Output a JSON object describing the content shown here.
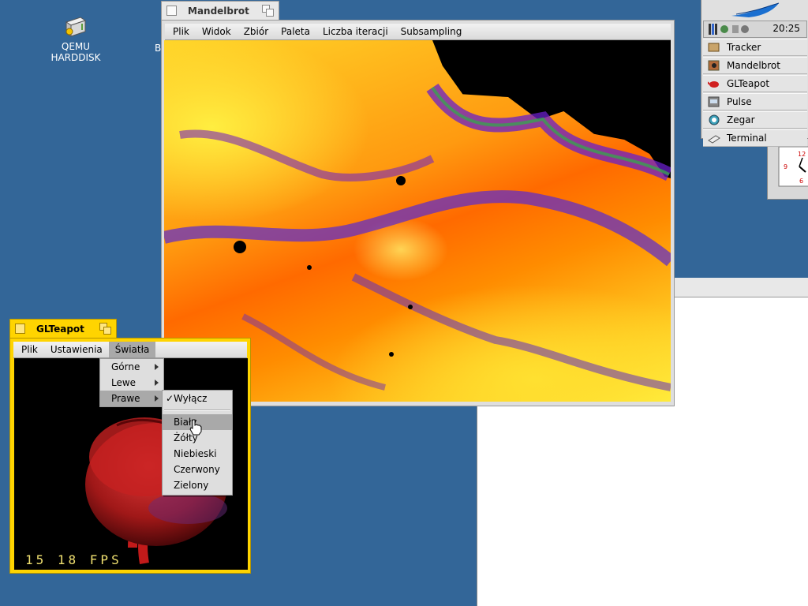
{
  "desktop": {
    "icons": [
      {
        "label": "QEMU HARDDISK",
        "icon": "harddisk-icon"
      },
      {
        "label": "B",
        "icon": "volume-icon"
      }
    ]
  },
  "mandelbrot": {
    "title": "Mandelbrot",
    "menu": [
      "Plik",
      "Widok",
      "Zbiór",
      "Paleta",
      "Liczba iteracji",
      "Subsampling"
    ]
  },
  "glteapot": {
    "title": "GLTeapot",
    "menu": [
      "Plik",
      "Ustawienia",
      "Światła"
    ],
    "open_menu": "Światła",
    "fps": "15 18 FPS",
    "lights_menu": [
      {
        "label": "Górne",
        "submenu": true
      },
      {
        "label": "Lewe",
        "submenu": true
      },
      {
        "label": "Prawe",
        "submenu": true,
        "selected": true
      }
    ],
    "right_submenu": {
      "checked_item": "Wyłącz",
      "items": [
        "Biały",
        "Żółty",
        "Niebieski",
        "Czerwony",
        "Zielony"
      ],
      "hovered": "Biały"
    }
  },
  "deskbar": {
    "clock": "20:25",
    "apps": [
      {
        "label": "Tracker",
        "icon": "tracker-icon"
      },
      {
        "label": "Mandelbrot",
        "icon": "mandelbrot-icon"
      },
      {
        "label": "GLTeapot",
        "icon": "teapot-icon"
      },
      {
        "label": "Pulse",
        "icon": "pulse-icon"
      },
      {
        "label": "Zegar",
        "icon": "clock-icon"
      },
      {
        "label": "Terminal",
        "icon": "terminal-icon"
      }
    ]
  },
  "colors": {
    "desktop": "#336698",
    "active_tab": "#ffd400",
    "menu_bg": "#dedede",
    "menu_highlight": "#a9a9a9"
  }
}
